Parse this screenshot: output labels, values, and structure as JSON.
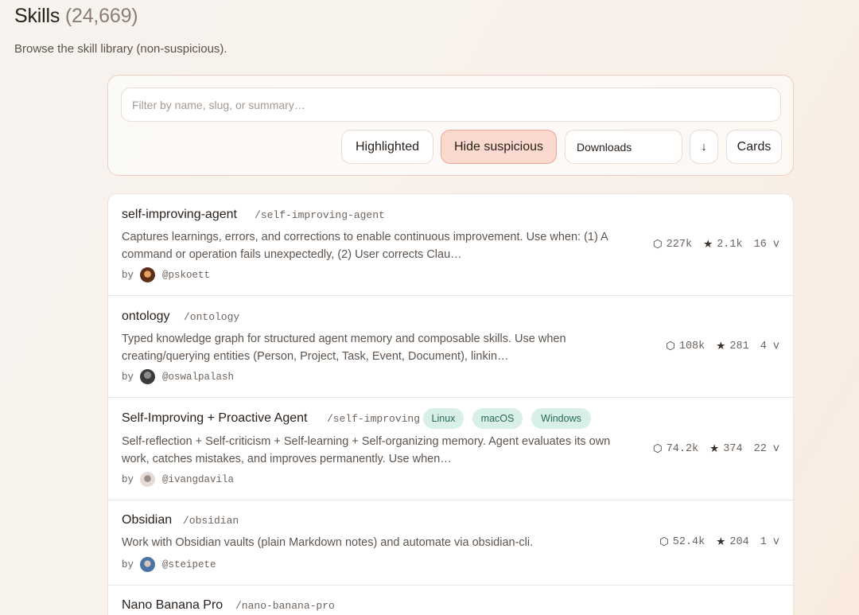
{
  "header": {
    "title": "Skills",
    "count": "(24,669)",
    "subtitle": "Browse the skill library (non-suspicious)."
  },
  "filters": {
    "search_placeholder": "Filter by name, slug, or summary…",
    "search_value": "",
    "highlighted_label": "Highlighted",
    "hide_suspicious_label": "Hide suspicious",
    "hide_suspicious_active": true,
    "sort_value": "Downloads",
    "sort_direction_icon": "↓",
    "view_label": "Cards"
  },
  "skills": [
    {
      "name": "self-improving-agent",
      "slug": "/self-improving-agent",
      "description": "Captures learnings, errors, and corrections to enable continuous improvement. Use when: (1) A command or operation fails unexpectedly, (2) User corrects Clau…",
      "by": "by",
      "author": "@pskoett",
      "downloads": "227k",
      "stars": "2.1k",
      "versions": "16 v",
      "tags": []
    },
    {
      "name": "ontology",
      "slug": "/ontology",
      "description": "Typed knowledge graph for structured agent memory and composable skills. Use when creating/querying entities (Person, Project, Task, Event, Document), linkin…",
      "by": "by",
      "author": "@oswalpalash",
      "downloads": "108k",
      "stars": "281",
      "versions": "4 v",
      "tags": []
    },
    {
      "name": "Self-Improving + Proactive Agent",
      "slug": "/self-improving",
      "description": "Self-reflection + Self-criticism + Self-learning + Self-organizing memory. Agent evaluates its own work, catches mistakes, and improves permanently. Use when…",
      "by": "by",
      "author": "@ivangdavila",
      "downloads": "74.2k",
      "stars": "374",
      "versions": "22 v",
      "tags": [
        "Linux",
        "macOS",
        "Windows"
      ]
    },
    {
      "name": "Obsidian",
      "slug": "/obsidian",
      "description": "Work with Obsidian vaults (plain Markdown notes) and automate via obsidian-cli.",
      "by": "by",
      "author": "@steipete",
      "downloads": "52.4k",
      "stars": "204",
      "versions": "1 v",
      "tags": []
    },
    {
      "name": "Nano Banana Pro",
      "slug": "/nano-banana-pro"
    }
  ],
  "icons": {
    "downloads": "package-icon",
    "stars": "star-icon"
  },
  "colors": {
    "accent": "#fbd9cf",
    "tag_bg": "#d9f0e8",
    "tag_text": "#256a58"
  }
}
